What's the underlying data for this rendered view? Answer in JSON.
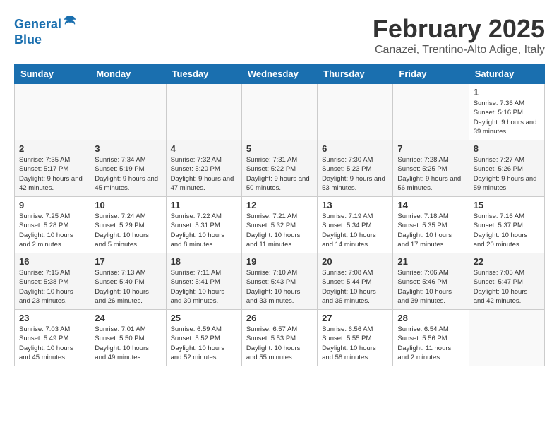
{
  "header": {
    "logo_line1": "General",
    "logo_line2": "Blue",
    "month": "February 2025",
    "location": "Canazei, Trentino-Alto Adige, Italy"
  },
  "weekdays": [
    "Sunday",
    "Monday",
    "Tuesday",
    "Wednesday",
    "Thursday",
    "Friday",
    "Saturday"
  ],
  "weeks": [
    [
      {
        "day": "",
        "info": ""
      },
      {
        "day": "",
        "info": ""
      },
      {
        "day": "",
        "info": ""
      },
      {
        "day": "",
        "info": ""
      },
      {
        "day": "",
        "info": ""
      },
      {
        "day": "",
        "info": ""
      },
      {
        "day": "1",
        "info": "Sunrise: 7:36 AM\nSunset: 5:16 PM\nDaylight: 9 hours and 39 minutes."
      }
    ],
    [
      {
        "day": "2",
        "info": "Sunrise: 7:35 AM\nSunset: 5:17 PM\nDaylight: 9 hours and 42 minutes."
      },
      {
        "day": "3",
        "info": "Sunrise: 7:34 AM\nSunset: 5:19 PM\nDaylight: 9 hours and 45 minutes."
      },
      {
        "day": "4",
        "info": "Sunrise: 7:32 AM\nSunset: 5:20 PM\nDaylight: 9 hours and 47 minutes."
      },
      {
        "day": "5",
        "info": "Sunrise: 7:31 AM\nSunset: 5:22 PM\nDaylight: 9 hours and 50 minutes."
      },
      {
        "day": "6",
        "info": "Sunrise: 7:30 AM\nSunset: 5:23 PM\nDaylight: 9 hours and 53 minutes."
      },
      {
        "day": "7",
        "info": "Sunrise: 7:28 AM\nSunset: 5:25 PM\nDaylight: 9 hours and 56 minutes."
      },
      {
        "day": "8",
        "info": "Sunrise: 7:27 AM\nSunset: 5:26 PM\nDaylight: 9 hours and 59 minutes."
      }
    ],
    [
      {
        "day": "9",
        "info": "Sunrise: 7:25 AM\nSunset: 5:28 PM\nDaylight: 10 hours and 2 minutes."
      },
      {
        "day": "10",
        "info": "Sunrise: 7:24 AM\nSunset: 5:29 PM\nDaylight: 10 hours and 5 minutes."
      },
      {
        "day": "11",
        "info": "Sunrise: 7:22 AM\nSunset: 5:31 PM\nDaylight: 10 hours and 8 minutes."
      },
      {
        "day": "12",
        "info": "Sunrise: 7:21 AM\nSunset: 5:32 PM\nDaylight: 10 hours and 11 minutes."
      },
      {
        "day": "13",
        "info": "Sunrise: 7:19 AM\nSunset: 5:34 PM\nDaylight: 10 hours and 14 minutes."
      },
      {
        "day": "14",
        "info": "Sunrise: 7:18 AM\nSunset: 5:35 PM\nDaylight: 10 hours and 17 minutes."
      },
      {
        "day": "15",
        "info": "Sunrise: 7:16 AM\nSunset: 5:37 PM\nDaylight: 10 hours and 20 minutes."
      }
    ],
    [
      {
        "day": "16",
        "info": "Sunrise: 7:15 AM\nSunset: 5:38 PM\nDaylight: 10 hours and 23 minutes."
      },
      {
        "day": "17",
        "info": "Sunrise: 7:13 AM\nSunset: 5:40 PM\nDaylight: 10 hours and 26 minutes."
      },
      {
        "day": "18",
        "info": "Sunrise: 7:11 AM\nSunset: 5:41 PM\nDaylight: 10 hours and 30 minutes."
      },
      {
        "day": "19",
        "info": "Sunrise: 7:10 AM\nSunset: 5:43 PM\nDaylight: 10 hours and 33 minutes."
      },
      {
        "day": "20",
        "info": "Sunrise: 7:08 AM\nSunset: 5:44 PM\nDaylight: 10 hours and 36 minutes."
      },
      {
        "day": "21",
        "info": "Sunrise: 7:06 AM\nSunset: 5:46 PM\nDaylight: 10 hours and 39 minutes."
      },
      {
        "day": "22",
        "info": "Sunrise: 7:05 AM\nSunset: 5:47 PM\nDaylight: 10 hours and 42 minutes."
      }
    ],
    [
      {
        "day": "23",
        "info": "Sunrise: 7:03 AM\nSunset: 5:49 PM\nDaylight: 10 hours and 45 minutes."
      },
      {
        "day": "24",
        "info": "Sunrise: 7:01 AM\nSunset: 5:50 PM\nDaylight: 10 hours and 49 minutes."
      },
      {
        "day": "25",
        "info": "Sunrise: 6:59 AM\nSunset: 5:52 PM\nDaylight: 10 hours and 52 minutes."
      },
      {
        "day": "26",
        "info": "Sunrise: 6:57 AM\nSunset: 5:53 PM\nDaylight: 10 hours and 55 minutes."
      },
      {
        "day": "27",
        "info": "Sunrise: 6:56 AM\nSunset: 5:55 PM\nDaylight: 10 hours and 58 minutes."
      },
      {
        "day": "28",
        "info": "Sunrise: 6:54 AM\nSunset: 5:56 PM\nDaylight: 11 hours and 2 minutes."
      },
      {
        "day": "",
        "info": ""
      }
    ]
  ]
}
